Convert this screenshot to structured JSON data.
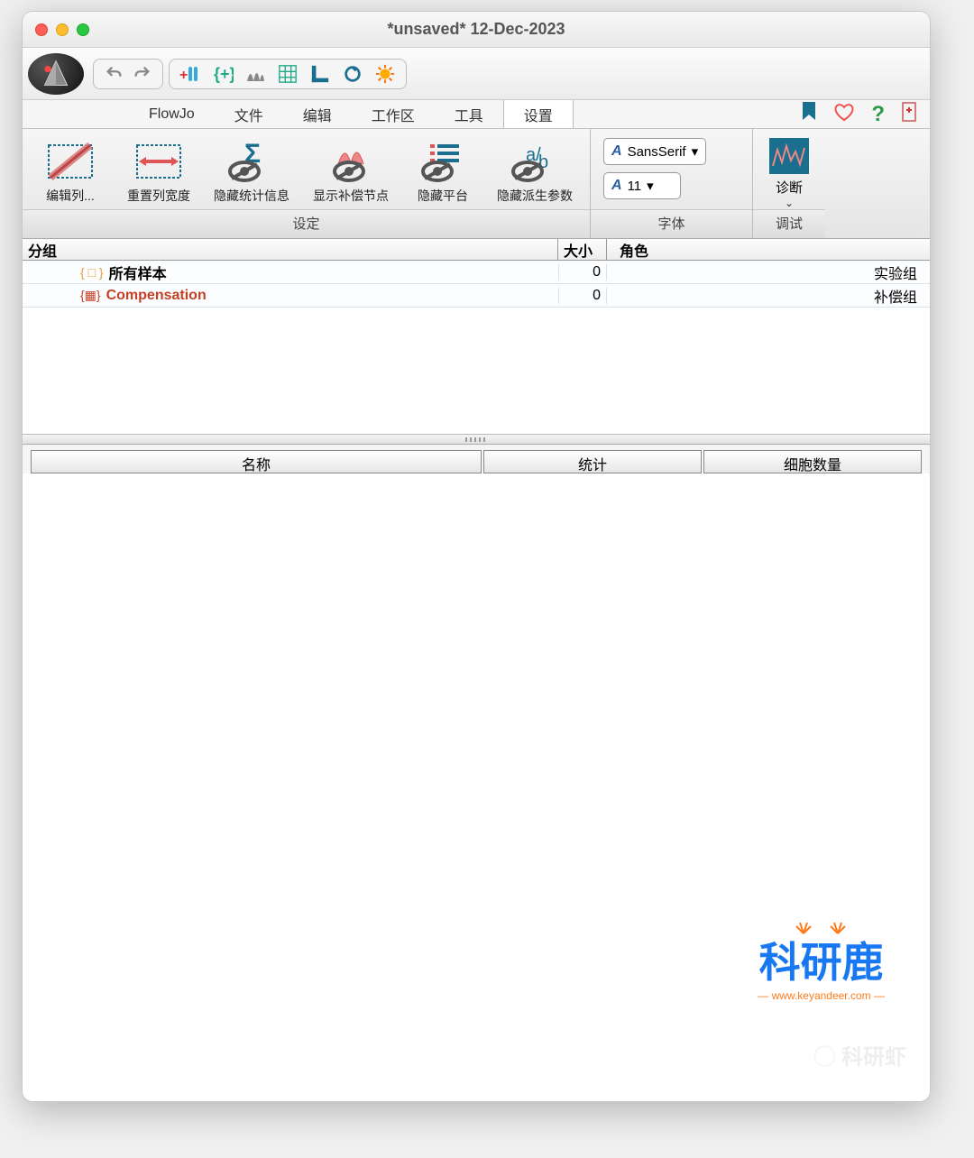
{
  "title": "*unsaved* 12-Dec-2023",
  "menu": {
    "flowjo": "FlowJo",
    "file": "文件",
    "edit": "编辑",
    "workspace": "工作区",
    "tools": "工具",
    "settings": "设置"
  },
  "ribbon": {
    "btns": {
      "editcol": "编辑列...",
      "resetcol": "重置列宽度",
      "hidestat": "隐藏统计信息",
      "showcomp": "显示补偿节点",
      "hideplat": "隐藏平台",
      "hidederiv": "隐藏派生参数",
      "diag": "诊断"
    },
    "groups": {
      "settings": "设定",
      "font": "字体",
      "debug": "调试"
    },
    "font": {
      "name": "SansSerif",
      "size": "11"
    }
  },
  "table1": {
    "headers": {
      "group": "分组",
      "size": "大小",
      "role": "角色"
    },
    "rows": [
      {
        "name": "所有样本",
        "size": "0",
        "role": "实验组",
        "color": "#222",
        "bold": true
      },
      {
        "name": "Compensation",
        "size": "0",
        "role": "补偿组",
        "color": "#c34027",
        "bold": true
      }
    ]
  },
  "table2": {
    "headers": {
      "name": "名称",
      "stat": "统计",
      "cells": "细胞数量"
    }
  },
  "watermark": {
    "big": "科研鹿",
    "url": "www.keyandeer.com",
    "wm2": "科研虾"
  }
}
